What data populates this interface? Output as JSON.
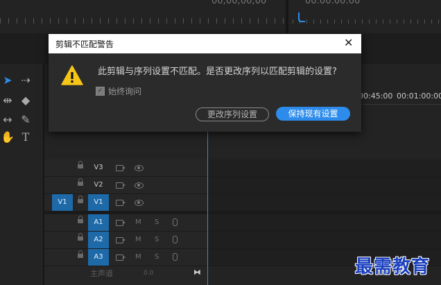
{
  "background": {
    "source_timecode": "00;00;00;00",
    "program_timecode": "00:00:00:00",
    "timeline_timecodes": [
      "00:45:00",
      "00:01:00:00"
    ]
  },
  "dialog": {
    "title": "剪辑不匹配警告",
    "message": "此剪辑与序列设置不匹配。是否更改序列以匹配剪辑的设置?",
    "checkbox_label": "始终询问",
    "checkbox_checked": true,
    "change_button": "更改序列设置",
    "keep_button": "保持现有设置"
  },
  "tracks": {
    "video": [
      "V3",
      "V2",
      "V1"
    ],
    "source_patch": "V1",
    "audio": [
      "A1",
      "A2",
      "A3"
    ],
    "mute": "M",
    "solo": "S",
    "master_label": "主声道",
    "master_value": "0.0"
  },
  "watermark": "最需教育",
  "colors": {
    "accent": "#2d8ceb",
    "target_on": "#1e6aa8"
  }
}
